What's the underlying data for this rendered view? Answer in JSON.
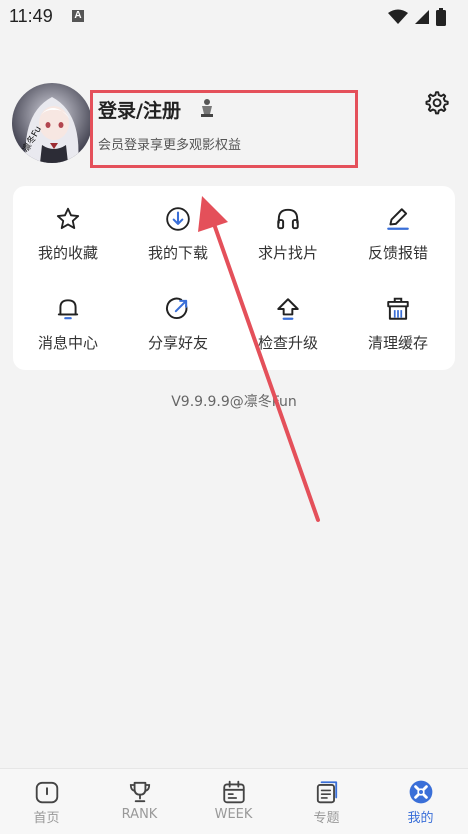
{
  "status": {
    "time": "11:49",
    "indicator": "A"
  },
  "profile": {
    "title": "登录/注册",
    "subtitle": "会员登录享更多观影权益"
  },
  "grid": [
    {
      "label": "我的收藏",
      "icon": "star-icon"
    },
    {
      "label": "我的下载",
      "icon": "download-icon"
    },
    {
      "label": "求片找片",
      "icon": "headphones-icon"
    },
    {
      "label": "反馈报错",
      "icon": "edit-icon"
    },
    {
      "label": "消息中心",
      "icon": "bell-icon"
    },
    {
      "label": "分享好友",
      "icon": "share-icon"
    },
    {
      "label": "检查升级",
      "icon": "upgrade-icon"
    },
    {
      "label": "清理缓存",
      "icon": "clean-icon"
    }
  ],
  "version": "V9.9.9.9@凛冬Fun",
  "nav": [
    {
      "label": "首页",
      "icon": "home-icon"
    },
    {
      "label": "RANK",
      "icon": "trophy-icon"
    },
    {
      "label": "WEEK",
      "icon": "calendar-icon"
    },
    {
      "label": "专题",
      "icon": "topics-icon"
    },
    {
      "label": "我的",
      "icon": "profile-icon"
    }
  ],
  "colors": {
    "accent": "#3a6fd8",
    "annotation": "#e4505a",
    "background": "#f3f3f3"
  }
}
